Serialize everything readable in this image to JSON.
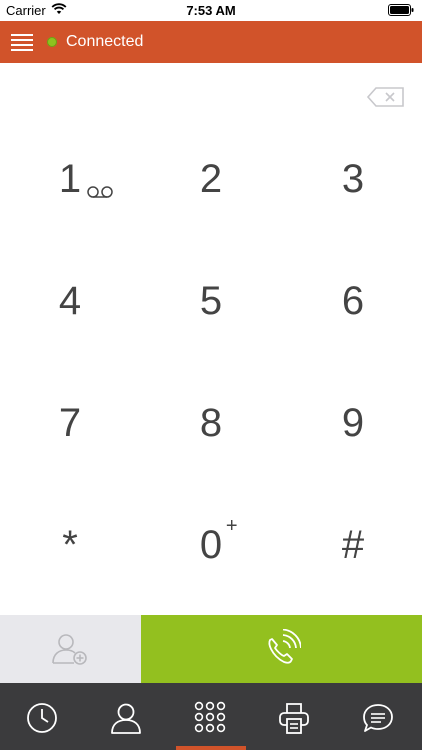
{
  "status_bar": {
    "carrier": "Carrier",
    "time": "7:53 AM"
  },
  "app_bar": {
    "connection_status": "Connected",
    "status_color": "#8dc21f",
    "accent": "#d1532a"
  },
  "keypad": {
    "keys": [
      {
        "digit": "1",
        "extra": "voicemail"
      },
      {
        "digit": "2"
      },
      {
        "digit": "3"
      },
      {
        "digit": "4"
      },
      {
        "digit": "5"
      },
      {
        "digit": "6"
      },
      {
        "digit": "7"
      },
      {
        "digit": "8"
      },
      {
        "digit": "9"
      },
      {
        "digit": "*"
      },
      {
        "digit": "0",
        "extra": "+"
      },
      {
        "digit": "#"
      }
    ]
  },
  "actions": {
    "call_color": "#93c01f"
  },
  "tabs": [
    {
      "icon": "clock-icon"
    },
    {
      "icon": "person-icon"
    },
    {
      "icon": "keypad-icon",
      "selected": true
    },
    {
      "icon": "fax-icon"
    },
    {
      "icon": "chat-bubble-icon"
    }
  ]
}
